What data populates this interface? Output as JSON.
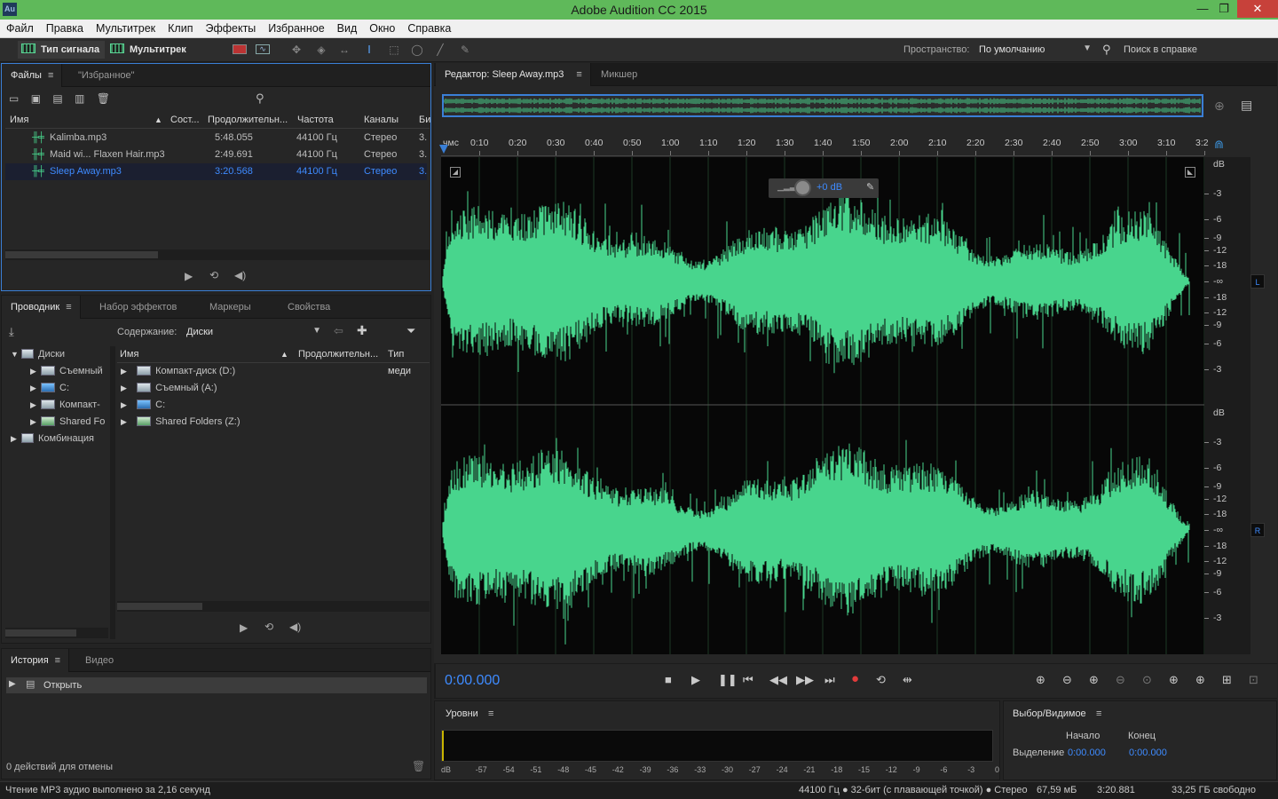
{
  "window": {
    "title": "Adobe Audition CC 2015",
    "app_icon": "Au",
    "min": "—",
    "restore": "❐",
    "close": "✕"
  },
  "menu": [
    "Файл",
    "Правка",
    "Мультитрек",
    "Клип",
    "Эффекты",
    "Избранное",
    "Вид",
    "Окно",
    "Справка"
  ],
  "toolbar": {
    "waveform_label": "Тип сигнала",
    "multitrack_label": "Мультитрек",
    "workspace_label": "Пространство:",
    "workspace_value": "По умолчанию",
    "search_placeholder": "Поиск в справке"
  },
  "files_panel": {
    "tab_files": "Файлы",
    "tab_favorites": "\"Избранное\"",
    "columns": [
      "Имя",
      "Сост...",
      "Продолжительн...",
      "Частота",
      "Каналы",
      "Би"
    ],
    "rows": [
      {
        "name": "Kalimba.mp3",
        "duration": "5:48.055",
        "rate": "44100 Гц",
        "channels": "Стерео",
        "bits": "3."
      },
      {
        "name": "Maid wi... Flaxen Hair.mp3",
        "duration": "2:49.691",
        "rate": "44100 Гц",
        "channels": "Стерео",
        "bits": "3."
      },
      {
        "name": "Sleep Away.mp3",
        "duration": "3:20.568",
        "rate": "44100 Гц",
        "channels": "Стерео",
        "bits": "3."
      }
    ]
  },
  "browser_panel": {
    "tabs": [
      "Проводник",
      "Набор эффектов",
      "Маркеры",
      "Свойства"
    ],
    "content_label": "Содержание:",
    "content_value": "Диски",
    "tree": [
      {
        "label": "Диски",
        "expanded": true
      },
      {
        "label": "Съемный"
      },
      {
        "label": "C:"
      },
      {
        "label": "Компакт-"
      },
      {
        "label": "Shared Fo"
      },
      {
        "label": "Комбинация"
      }
    ],
    "columns": [
      "Имя",
      "Продолжительн...",
      "Тип меди"
    ],
    "items": [
      "Компакт-диск (D:)",
      "Съемный (A:)",
      "C:",
      "Shared Folders (Z:)"
    ]
  },
  "history_panel": {
    "tabs": [
      "История",
      "Видео"
    ],
    "item": "Открыть",
    "undo_status": "0 действий для отмены"
  },
  "editor": {
    "tab_editor": "Редактор: Sleep Away.mp3",
    "tab_mixer": "Микшер",
    "ruler_unit": "чмс",
    "ruler_ticks": [
      "0:10",
      "0:20",
      "0:30",
      "0:40",
      "0:50",
      "1:00",
      "1:10",
      "1:20",
      "1:30",
      "1:40",
      "1:50",
      "2:00",
      "2:10",
      "2:20",
      "2:30",
      "2:40",
      "2:50",
      "3:00",
      "3:10",
      "3:2"
    ],
    "hud_gain": "+0 dB",
    "db_label": "dB",
    "db_ticks": [
      "-3",
      "-6",
      "-9",
      "-12",
      "-18",
      "-∞",
      "-18",
      "-12",
      "-9",
      "-6",
      "-3"
    ],
    "channel_left": "L",
    "channel_right": "R",
    "time_display": "0:00.000",
    "wave_color": "#48d58d",
    "selection_color": "#3a7fd6"
  },
  "levels": {
    "title": "Уровни",
    "scale": [
      "dB",
      "-57",
      "-54",
      "-51",
      "-48",
      "-45",
      "-42",
      "-39",
      "-36",
      "-33",
      "-30",
      "-27",
      "-24",
      "-21",
      "-18",
      "-15",
      "-12",
      "-9",
      "-6",
      "-3",
      "0"
    ]
  },
  "selection": {
    "title": "Выбор/Видимое",
    "start_label": "Начало",
    "end_label": "Конец",
    "row_label": "Выделение",
    "start_value": "0:00.000",
    "end_value": "0:00.000"
  },
  "status": {
    "left": "Чтение MP3 аудио выполнено за 2,16 секунд",
    "format": "44100 Гц ● 32-бит (с плавающей точкой) ● Стерео",
    "size": "67,59 мБ",
    "duration": "3:20.881",
    "free": "33,25 ГБ свободно"
  }
}
